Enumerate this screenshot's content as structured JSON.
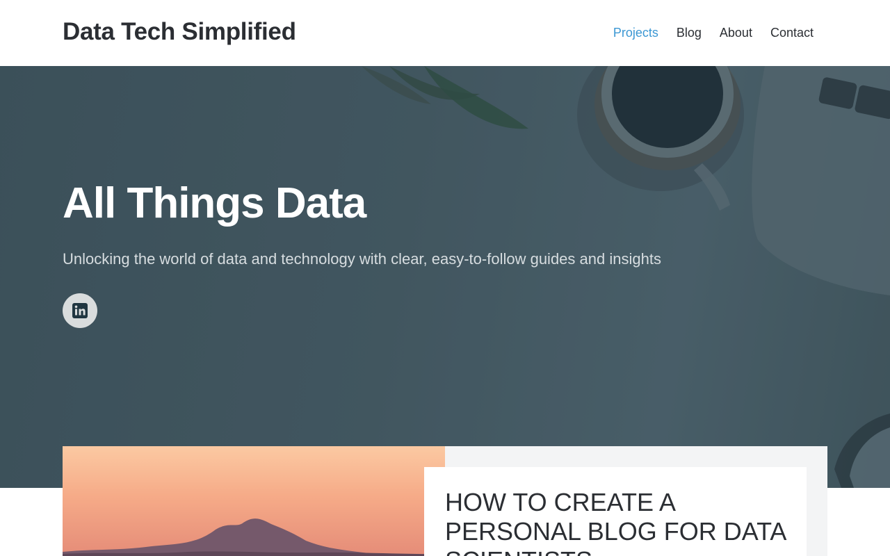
{
  "header": {
    "site_title": "Data Tech Simplified",
    "nav": [
      {
        "label": "Projects",
        "active": true
      },
      {
        "label": "Blog",
        "active": false
      },
      {
        "label": "About",
        "active": false
      },
      {
        "label": "Contact",
        "active": false
      }
    ]
  },
  "hero": {
    "title": "All Things Data",
    "subtitle": "Unlocking the world of data and technology with clear, easy-to-follow guides and insights",
    "social_icon": "linkedin-icon"
  },
  "featured_post": {
    "title": "HOW TO CREATE A PERSONAL BLOG FOR DATA SCIENTISTS"
  },
  "colors": {
    "accent": "#3b97d3",
    "text": "#2b2e33",
    "hero_overlay": "#465b65"
  }
}
